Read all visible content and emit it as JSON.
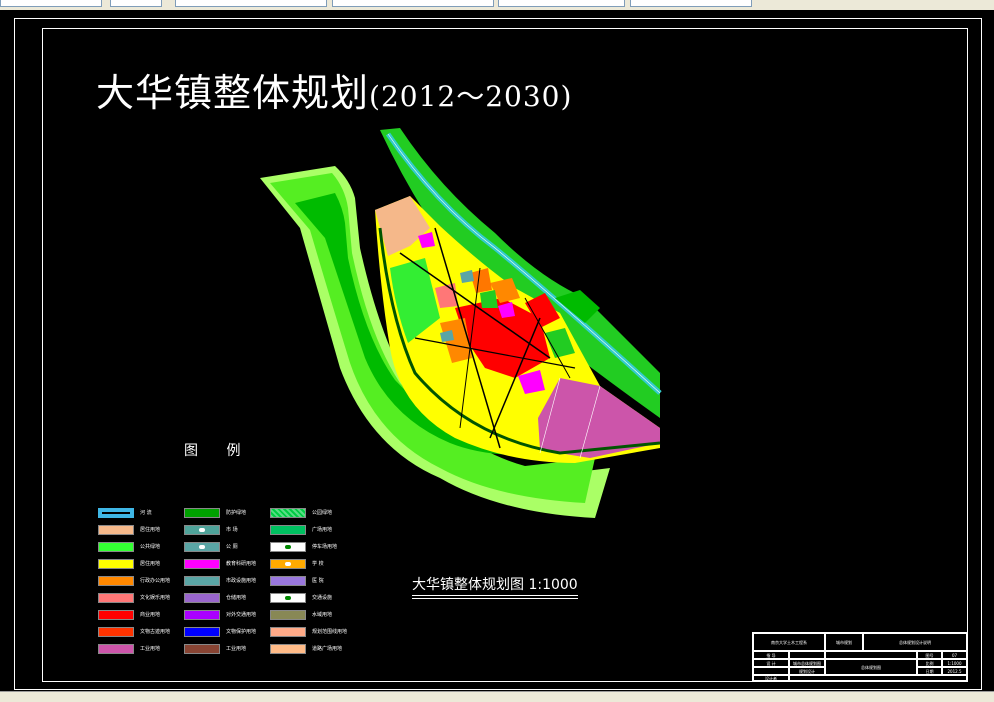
{
  "map": {
    "title_main": "大华镇整体规划",
    "title_years": "(2012～2030)",
    "legend_title": "图  例",
    "scale_title": "大华镇整体规划图  1:1000",
    "legend_items": [
      {
        "color": "#3fb7e6",
        "label": "河  流",
        "icon": "river-swatch"
      },
      {
        "color": "#00a000",
        "label": "防护绿地"
      },
      {
        "color": "#00cc44",
        "label": "公园绿地",
        "icon": "hatched"
      },
      {
        "color": "#f5b88a",
        "label": "居住用地"
      },
      {
        "color": "#4fa39a",
        "label": "市  场",
        "icon": "dot"
      },
      {
        "color": "#00c060",
        "label": "广场用地"
      },
      {
        "color": "#33ff33",
        "label": "公共绿地"
      },
      {
        "color": "#5aa5a5",
        "label": "公  厕",
        "icon": "dot"
      },
      {
        "color": "#ffffff",
        "label": "停车场用地",
        "icon": "parking"
      },
      {
        "color": "#ffff00",
        "label": "居住用地"
      },
      {
        "color": "#ff00ff",
        "label": "教育科研用地"
      },
      {
        "color": "#ffaa00",
        "label": "学  校",
        "icon": "dot"
      },
      {
        "color": "#ff8800",
        "label": "行政办公用地"
      },
      {
        "color": "#5aa5a5",
        "label": "市政设施用地"
      },
      {
        "color": "#9977dd",
        "label": "医  院"
      },
      {
        "color": "#ff7777",
        "label": "文化娱乐用地"
      },
      {
        "color": "#9966cc",
        "label": "仓储用地"
      },
      {
        "color": "#ffffff",
        "label": "交通设施",
        "icon": "oval"
      },
      {
        "color": "#ff0000",
        "label": "商业用地"
      },
      {
        "color": "#aa00ff",
        "label": "对外交通用地"
      },
      {
        "color": "#888855",
        "label": "水域用地"
      },
      {
        "color": "#ff3300",
        "label": "文物古迹用地"
      },
      {
        "color": "#0000ff",
        "label": "文物保护用地"
      },
      {
        "color": "#ffaa88",
        "label": "规划范围线用地"
      },
      {
        "color": "#cc55aa",
        "label": "工业用地"
      },
      {
        "color": "#884433",
        "label": "工业用地"
      },
      {
        "color": "#ffbb88",
        "label": "道路广场用地"
      }
    ],
    "title_block": {
      "c1": "南京大学土木工程系",
      "c2": "城市规划",
      "c3": "总体规划设计说明",
      "r2a": "指  导",
      "r2b": "图号",
      "r2c": "07",
      "r3a": "设  计",
      "r3b": "城市总体规划图",
      "r3c": "总体规划图",
      "r3d": "比例",
      "r3e": "1:1000",
      "r4a": "设计者",
      "r4b": "规划设计",
      "r4d": "日期",
      "r4e": "2012.5"
    }
  },
  "colors": {
    "background": "#000000",
    "frame": "#ffffff",
    "green_buffer": "#33dd22",
    "residential": "#ffff00",
    "commercial": "#ff0000",
    "industrial": "#cc55aa",
    "river": "#33cccc"
  }
}
